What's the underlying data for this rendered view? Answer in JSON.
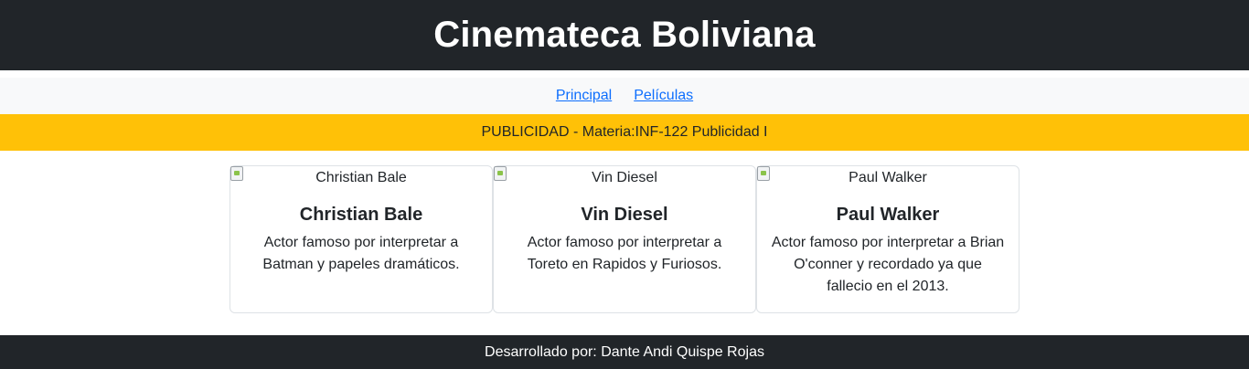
{
  "header": {
    "title": "Cinemateca Boliviana"
  },
  "nav": {
    "items": [
      {
        "label": "Principal"
      },
      {
        "label": "Películas"
      }
    ]
  },
  "ad": {
    "text": "PUBLICIDAD - Materia:INF-122 Publicidad I"
  },
  "cards": [
    {
      "image_alt": "Christian Bale",
      "title": "Christian Bale",
      "text": "Actor famoso por interpretar a Batman y papeles dramáticos."
    },
    {
      "image_alt": "Vin Diesel",
      "title": "Vin Diesel",
      "text": "Actor famoso por interpretar a Toreto en Rapidos y Furiosos."
    },
    {
      "image_alt": "Paul Walker",
      "title": "Paul Walker",
      "text": "Actor famoso por interpretar a Brian O'conner y recordado ya que fallecio en el 2013."
    }
  ],
  "footer": {
    "text": "Desarrollado por: Dante Andi Quispe Rojas"
  },
  "colors": {
    "header_bg": "#212529",
    "nav_bg": "#f8f9fa",
    "link": "#0d6efd",
    "ad_bg": "#ffc107",
    "footer_bg": "#212529"
  }
}
